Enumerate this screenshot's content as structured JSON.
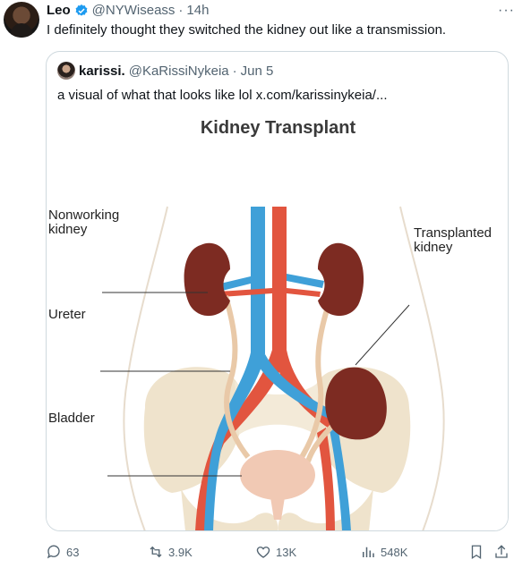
{
  "tweet": {
    "author_name": "Leo",
    "handle": "@NYWiseass",
    "separator": "·",
    "time": "14h",
    "text": "I definitely thought they switched the kidney out like a transmission."
  },
  "quoted": {
    "author_name": "karissi.",
    "handle": "@KaRissiNykeia",
    "separator": "·",
    "date": "Jun 5",
    "text": "a visual of what that looks like lol  x.com/karissinykeia/..."
  },
  "figure": {
    "title": "Kidney Transplant",
    "labels": {
      "nonworking_line1": "Nonworking",
      "nonworking_line2": "kidney",
      "ureter": "Ureter",
      "bladder": "Bladder",
      "transplanted_line1": "Transplanted",
      "transplanted_line2": "kidney"
    }
  },
  "actions": {
    "replies": "63",
    "reposts": "3.9K",
    "likes": "13K",
    "views": "548K"
  },
  "colors": {
    "verified": "#1d9bf0",
    "artery": "#e2553f",
    "vein": "#3fa0d8",
    "kidney": "#7d2b22",
    "bone": "#efe3cc",
    "muted": "#536471"
  }
}
